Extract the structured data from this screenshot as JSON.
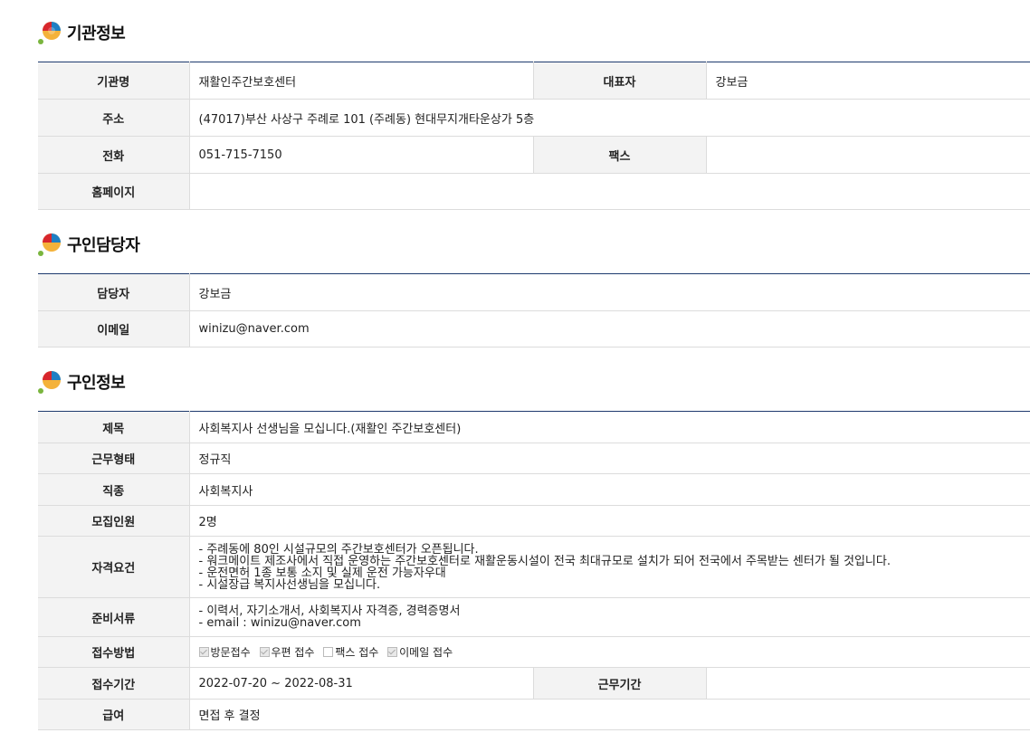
{
  "sections": {
    "org": {
      "title": "기관정보",
      "name_label": "기관명",
      "name": "재활인주간보호센터",
      "ceo_label": "대표자",
      "ceo": "강보금",
      "addr_label": "주소",
      "addr": "(47017)부산 사상구 주례로 101 (주례동) 현대무지개타운상가 5층",
      "phone_label": "전화",
      "phone": "051-715-7150",
      "fax_label": "팩스",
      "fax": "",
      "home_label": "홈페이지",
      "home": ""
    },
    "contact": {
      "title": "구인담당자",
      "person_label": "담당자",
      "person": "강보금",
      "email_label": "이메일",
      "email": "winizu@naver.com"
    },
    "job": {
      "title": "구인정보",
      "subject_label": "제목",
      "subject": "사회복지사 선생님을 모십니다.(재활인 주간보호센터)",
      "type_label": "근무형태",
      "type": "정규직",
      "occupation_label": "직종",
      "occupation": "사회복지사",
      "count_label": "모집인원",
      "count": "2명",
      "req_label": "자격요건",
      "req_lines": [
        "- 주례동에 80인 시설규모의 주간보호센터가 오픈됩니다.",
        "- 워크메이트 제조사에서 직접 운영하는 주간보호센터로 재활운동시설이 전국 최대규모로 설치가 되어 전국에서 주목받는 센터가 될 것입니다.",
        "- 운전면허 1종 보통 소지 및 실제 운전 가능자우대",
        "- 시설장급 복지사선생님을 모십니다."
      ],
      "docs_label": "준비서류",
      "docs_lines": [
        "- 이력서, 자기소개서,  사회복지사 자격증, 경력증명서",
        "- email : winizu@naver.com"
      ],
      "method_label": "접수방법",
      "methods": [
        {
          "label": "방문접수",
          "checked": true
        },
        {
          "label": "우편 접수",
          "checked": true
        },
        {
          "label": "팩스 접수",
          "checked": false
        },
        {
          "label": "이메일 접수",
          "checked": true
        }
      ],
      "period_label": "접수기간",
      "period": "2022-07-20 ~ 2022-08-31",
      "workperiod_label": "근무기간",
      "workperiod": "",
      "salary_label": "급여",
      "salary": "면접 후 결정"
    }
  }
}
